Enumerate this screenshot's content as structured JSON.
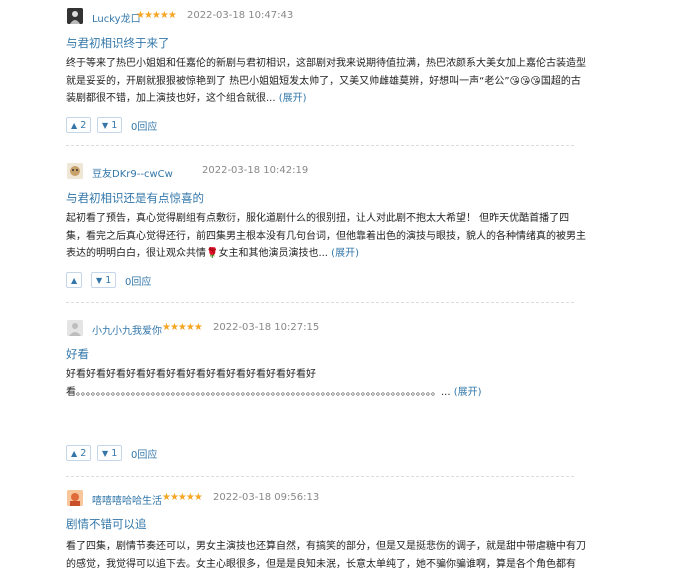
{
  "reviews": [
    {
      "username": "Lucky龙口",
      "stars": "★★★★★",
      "date": "2022-03-18 10:47:43",
      "title": "与君初相识终于来了",
      "body": "终于等来了热巴小姐姐和任嘉伦的新剧与君初相识，这部剧对我来说期待值拉满，热巴浓颜系大美女加上嘉伦古装造型就是妥妥的，开剧就狠狠被惊艳到了 热巴小姐姐短发太帅了，又美又帅雌雄莫辨，好想叫一声“老公”😘😘😘国超的古装剧都很不错，加上演技也好，这个组合就很... ",
      "expand": "(展开)",
      "upvotes": "2",
      "downvotes": "1",
      "replies": "0回应"
    },
    {
      "username": "豆友DKr9--cwCw",
      "stars": "",
      "date": "2022-03-18 10:42:19",
      "title": "与君初相识还是有点惊喜的",
      "body": "起初看了预告，真心觉得剧组有点敷衍，服化道剧什么的很别扭，让人对此剧不抱太大希望！ 但昨天优酷首播了四集，看完之后真心觉得还行，前四集男主根本没有几句台词，但他靠着出色的演技与眼技，貌人的各种情绪真的被男主表达的明明白白，很让观众共情🌹女主和其他演员演技也... ",
      "expand": "(展开)",
      "upvotes": "",
      "downvotes": "1",
      "replies": "0回应"
    },
    {
      "username": "小九小九我爱你",
      "stars": "★★★★★",
      "date": "2022-03-18 10:27:15",
      "title": "好看",
      "body": "好看好看好看好看好看好看好看好看好看好看好看好看好看。。。。。。。。。。。。。。。。。。。。。。。。。。。。。。。。。。。。。。。。。。。。。。。。。。。。。。。。。。。。。。。。。。。。。。。。... ",
      "expand": "(展开)",
      "upvotes": "2",
      "downvotes": "1",
      "replies": "0回应"
    },
    {
      "username": "嘻嘻嘻哈哈生活",
      "stars": "★★★★★",
      "date": "2022-03-18 09:56:13",
      "title": "剧情不错可以追",
      "body": "看了四集，剧情节奏还可以，男女主演技也还算自然，有搞笑的部分，但是又是挺悲伤的调子，就是甜中带虐糖中有刀的感觉，我觉得可以追下去。女主心眼很多，但是是良知未泯，长意太单纯了，她不骗你骗谁啊，算是各个角色都有",
      "expand": "",
      "upvotes": "",
      "downvotes": "",
      "replies": ""
    }
  ],
  "icons": {
    "up": "▲",
    "down": "▼"
  },
  "colors": {
    "link": "#3377aa",
    "star": "#f5a623",
    "date": "#888888"
  }
}
